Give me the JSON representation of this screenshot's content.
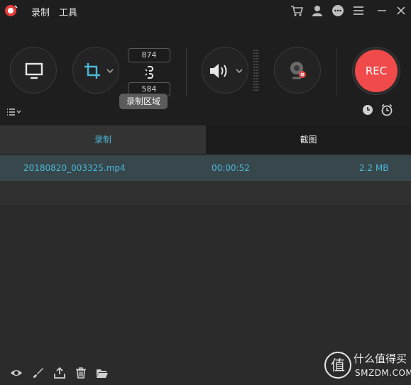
{
  "menu": {
    "record": "录制",
    "tools": "工具"
  },
  "dimensions": {
    "width": "874",
    "height": "584"
  },
  "tooltip": "录制区域",
  "rec_label": "REC",
  "tabs": [
    {
      "label": "录制"
    },
    {
      "label": "截图"
    }
  ],
  "files": [
    {
      "name": "20180820_003325.mp4",
      "duration": "00:00:52",
      "size": "2.2 MB"
    }
  ],
  "watermark": {
    "line1": "什么值得买",
    "line2": "SMZDM.COM",
    "glyph": "值"
  },
  "colors": {
    "accent": "#4cb8d8",
    "rec": "#f04a4a",
    "selected_row": "#37474b"
  }
}
